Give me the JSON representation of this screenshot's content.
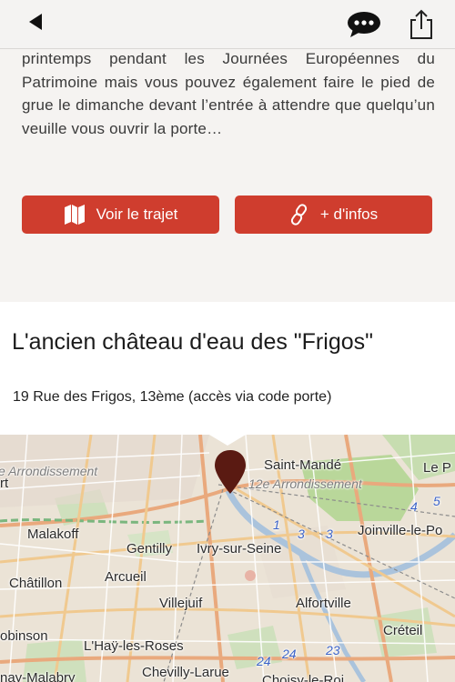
{
  "description": "printemps pendant les Journées Européennes du Patrimoine mais vous pouvez également faire le pied de grue le dimanche devant l’entrée à attendre que quelqu’un veuille vous ouvrir la porte…",
  "buttons": {
    "route_label": "Voir le trajet",
    "info_label": "+ d'infos"
  },
  "place": {
    "title": "L'ancien château d'eau des \"Frigos\"",
    "address": "19 Rue des Frigos, 13ème (accès via code porte)"
  },
  "map": {
    "labels": {
      "arr_left": "e Arrondissement",
      "rt": "rt",
      "saint_mande": "Saint-Mandé",
      "le_p": "Le P",
      "arr12": "12e Arrondissement",
      "malakoff": "Malakoff",
      "gentilly": "Gentilly",
      "ivry": "Ivry-sur-Seine",
      "joinville": "Joinville-le-Po",
      "chatillon": "Châtillon",
      "arcueil": "Arcueil",
      "villejuif": "Villejuif",
      "alfortville": "Alfortville",
      "robinson": "obinson",
      "creteil": "Créteil",
      "lhay": "L'Haÿ-les-Roses",
      "malabry": "nay-Malabry",
      "chevilly": "Chevilly-Larue",
      "choisy": "Choisy-le-Roi",
      "r1": "1",
      "r3a": "3",
      "r3b": "3",
      "r4": "4",
      "r5": "5",
      "r24a": "24",
      "r24b": "24",
      "r23": "23"
    }
  },
  "colors": {
    "accent": "#cf3d2e",
    "pin": "#5a1a12"
  }
}
